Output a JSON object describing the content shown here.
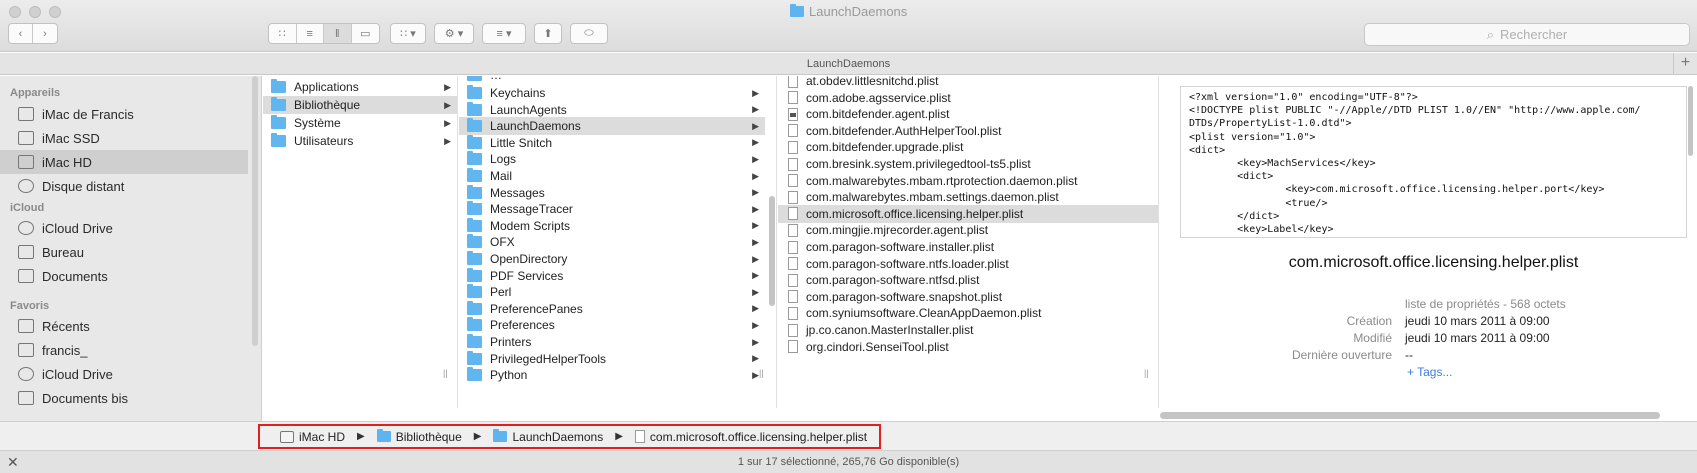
{
  "window": {
    "title": "LaunchDaemons",
    "path_title": "LaunchDaemons",
    "search_placeholder": "Rechercher"
  },
  "sidebar": {
    "sections": [
      {
        "heading": "Appareils",
        "items": [
          {
            "label": "iMac de Francis",
            "icon": "imac-icon"
          },
          {
            "label": "iMac SSD",
            "icon": "drive-icon"
          },
          {
            "label": "iMac HD",
            "icon": "drive-icon",
            "selected": true
          },
          {
            "label": "Disque distant",
            "icon": "disc-icon"
          }
        ]
      },
      {
        "heading": "iCloud",
        "items": [
          {
            "label": "iCloud Drive",
            "icon": "cloud-icon"
          },
          {
            "label": "Bureau",
            "icon": "desktop-icon"
          },
          {
            "label": "Documents",
            "icon": "documents-icon"
          }
        ]
      },
      {
        "heading": "Favoris",
        "items": [
          {
            "label": "Récents",
            "icon": "recents-icon"
          },
          {
            "label": "francis_",
            "icon": "home-icon"
          },
          {
            "label": "iCloud Drive",
            "icon": "cloud-icon"
          },
          {
            "label": "Documents bis",
            "icon": "folder-icon"
          }
        ]
      }
    ]
  },
  "column1": [
    {
      "label": "Applications"
    },
    {
      "label": "Bibliothèque",
      "selected": true
    },
    {
      "label": "Système"
    },
    {
      "label": "Utilisateurs"
    }
  ],
  "column2": [
    {
      "label": "Keychains"
    },
    {
      "label": "LaunchAgents"
    },
    {
      "label": "LaunchDaemons",
      "selected": true
    },
    {
      "label": "Little Snitch"
    },
    {
      "label": "Logs"
    },
    {
      "label": "Mail"
    },
    {
      "label": "Messages"
    },
    {
      "label": "MessageTracer"
    },
    {
      "label": "Modem Scripts"
    },
    {
      "label": "OFX"
    },
    {
      "label": "OpenDirectory"
    },
    {
      "label": "PDF Services"
    },
    {
      "label": "Perl"
    },
    {
      "label": "PreferencePanes"
    },
    {
      "label": "Preferences"
    },
    {
      "label": "Printers"
    },
    {
      "label": "PrivilegedHelperTools"
    },
    {
      "label": "Python"
    }
  ],
  "column3": [
    {
      "label": "at.obdev.littlesnitchd.plist"
    },
    {
      "label": "com.adobe.agsservice.plist"
    },
    {
      "label": "com.bitdefender.agent.plist"
    },
    {
      "label": "com.bitdefender.AuthHelperTool.plist"
    },
    {
      "label": "com.bitdefender.upgrade.plist"
    },
    {
      "label": "com.bresink.system.privilegedtool-ts5.plist"
    },
    {
      "label": "com.malwarebytes.mbam.rtprotection.daemon.plist"
    },
    {
      "label": "com.malwarebytes.mbam.settings.daemon.plist"
    },
    {
      "label": "com.microsoft.office.licensing.helper.plist",
      "selected": true
    },
    {
      "label": "com.mingjie.mjrecorder.agent.plist"
    },
    {
      "label": "com.paragon-software.installer.plist"
    },
    {
      "label": "com.paragon-software.ntfs.loader.plist"
    },
    {
      "label": "com.paragon-software.ntfsd.plist"
    },
    {
      "label": "com.paragon-software.snapshot.plist"
    },
    {
      "label": "com.syniumsoftware.CleanAppDaemon.plist"
    },
    {
      "label": "jp.co.canon.MasterInstaller.plist"
    },
    {
      "label": "org.cindori.SenseiTool.plist"
    }
  ],
  "preview": {
    "code": "<?xml version=\"1.0\" encoding=\"UTF-8\"?>\n<!DOCTYPE plist PUBLIC \"-//Apple//DTD PLIST 1.0//EN\" \"http://www.apple.com/\nDTDs/PropertyList-1.0.dtd\">\n<plist version=\"1.0\">\n<dict>\n        <key>MachServices</key>\n        <dict>\n                <key>com.microsoft.office.licensing.helper.port</key>\n                <true/>\n        </dict>\n        <key>Label</key>\n        <string>com.microsoft.office.licensing.helper</string>",
    "filename": "com.microsoft.office.licensing.helper.plist",
    "kind": "liste de propriétés - 568 octets",
    "created_label": "Création",
    "created_value": "jeudi 10 mars 2011 à 09:00",
    "modified_label": "Modifié",
    "modified_value": "jeudi 10 mars 2011 à 09:00",
    "opened_label": "Dernière ouverture",
    "opened_value": "--",
    "tags_label": "+ Tags..."
  },
  "pathbar": {
    "items": [
      "iMac HD",
      "Bibliothèque",
      "LaunchDaemons",
      "com.microsoft.office.licensing.helper.plist"
    ],
    "highlight_color": "#e01f1f"
  },
  "status": {
    "text": "1 sur 17 sélectionné, 265,76 Go disponible(s)"
  }
}
